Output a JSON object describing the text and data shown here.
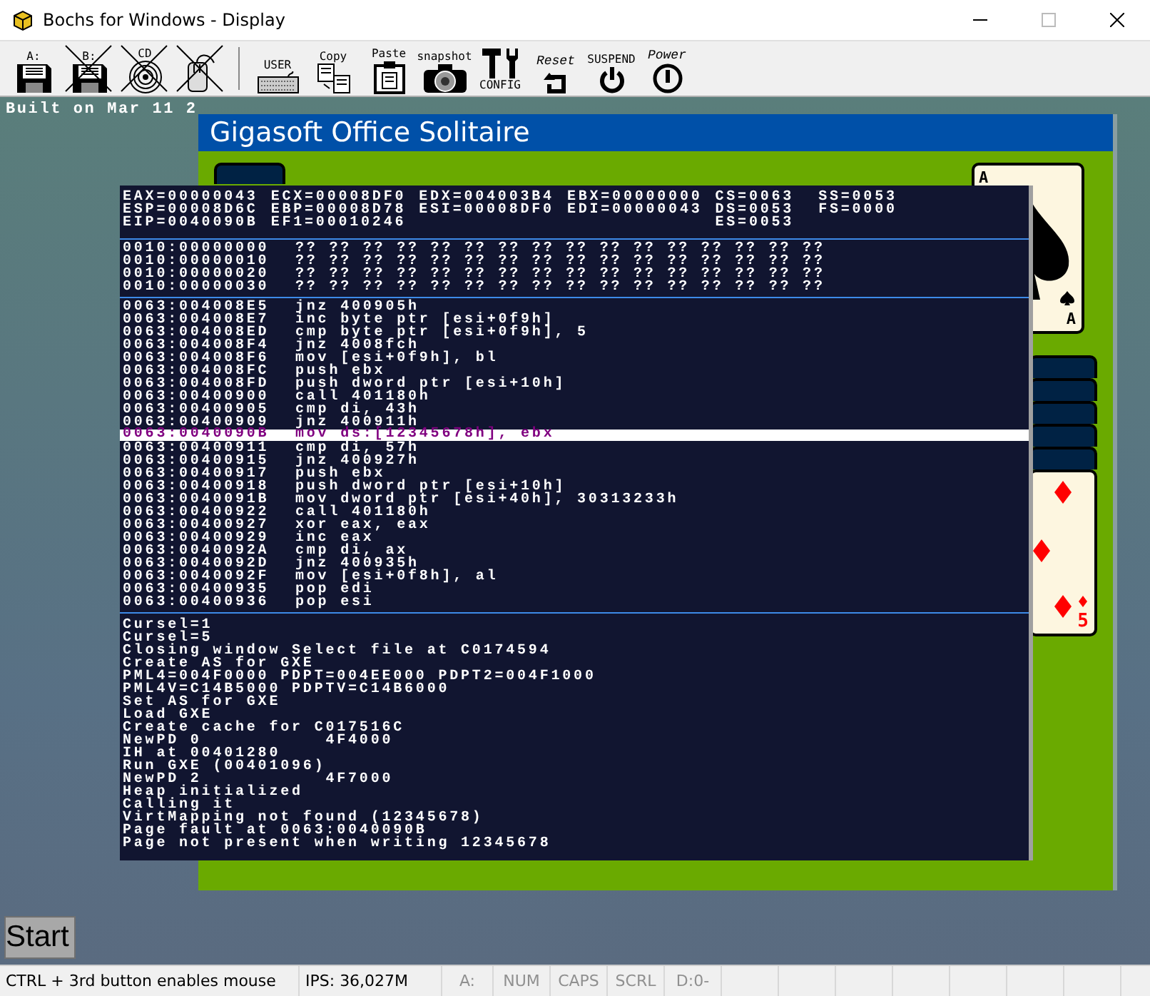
{
  "window": {
    "title": "Bochs for Windows - Display"
  },
  "toolbar": [
    {
      "kind": "floppy",
      "label": "A:",
      "disabled": false
    },
    {
      "kind": "floppy",
      "label": "B:",
      "disabled": true
    },
    {
      "kind": "cdrom",
      "label": "CD",
      "disabled": true
    },
    {
      "kind": "mouse",
      "disabled": true
    },
    {
      "kind": "separator"
    },
    {
      "kind": "keyboard",
      "label": "USER",
      "disabled": false
    },
    {
      "kind": "copy",
      "label": "Copy",
      "disabled": false
    },
    {
      "kind": "paste",
      "label": "Paste",
      "disabled": false
    },
    {
      "kind": "camera",
      "label": "snapshot",
      "disabled": false
    },
    {
      "kind": "config",
      "label": "CONFIG",
      "disabled": false
    },
    {
      "kind": "reset",
      "label": "Reset",
      "disabled": false
    },
    {
      "kind": "suspend",
      "label": "SUSPEND",
      "disabled": false
    },
    {
      "kind": "power",
      "label": "Power",
      "disabled": false
    }
  ],
  "display": {
    "boot_text": "Built on Mar 11 2",
    "solitaire": {
      "title": "Gigasoft Office Solitaire",
      "cards": [
        {
          "kind": "back"
        },
        {
          "kind": "spades",
          "corner_labels": [
            "A",
            "A"
          ]
        },
        {
          "kind": "diamond-stack",
          "corner_labels": [
            "5"
          ]
        }
      ]
    },
    "debugger": {
      "registers": [
        [
          "EAX=00000043",
          "ESP=00008D6C",
          "EIP=0040090B"
        ],
        [
          "ECX=00008DF0",
          "EBP=00008D78",
          "EF1=00010246"
        ],
        [
          "EDX=004003B4",
          "ESI=00008DF0"
        ],
        [
          "EBX=00000000",
          "EDI=00000043"
        ],
        [
          "CS=0063",
          "DS=0053",
          "ES=0053"
        ],
        [
          "SS=0053",
          "FS=0000"
        ]
      ],
      "memory": [
        {
          "address": "0010:00000000",
          "bytes": "?? ?? ?? ?? ?? ?? ?? ?? ?? ?? ?? ?? ?? ?? ?? ??"
        },
        {
          "address": "0010:00000010",
          "bytes": "?? ?? ?? ?? ?? ?? ?? ?? ?? ?? ?? ?? ?? ?? ?? ??"
        },
        {
          "address": "0010:00000020",
          "bytes": "?? ?? ?? ?? ?? ?? ?? ?? ?? ?? ?? ?? ?? ?? ?? ??"
        },
        {
          "address": "0010:00000030",
          "bytes": "?? ?? ?? ?? ?? ?? ?? ?? ?? ?? ?? ?? ?? ?? ?? ??"
        }
      ],
      "disassembly": [
        {
          "address": "0063:004008E5",
          "instruction": "jnz 400905h",
          "selected": false
        },
        {
          "address": "0063:004008E7",
          "instruction": "inc byte ptr [esi+0f9h]",
          "selected": false
        },
        {
          "address": "0063:004008ED",
          "instruction": "cmp byte ptr [esi+0f9h], 5",
          "selected": false
        },
        {
          "address": "0063:004008F4",
          "instruction": "jnz 4008fch",
          "selected": false
        },
        {
          "address": "0063:004008F6",
          "instruction": "mov [esi+0f9h], bl",
          "selected": false
        },
        {
          "address": "0063:004008FC",
          "instruction": "push ebx",
          "selected": false
        },
        {
          "address": "0063:004008FD",
          "instruction": "push dword ptr [esi+10h]",
          "selected": false
        },
        {
          "address": "0063:00400900",
          "instruction": "call 401180h",
          "selected": false
        },
        {
          "address": "0063:00400905",
          "instruction": "cmp di, 43h",
          "selected": false
        },
        {
          "address": "0063:00400909",
          "instruction": "jnz 400911h",
          "selected": false
        },
        {
          "address": "0063:0040090B",
          "instruction": "mov ds:[12345678h], ebx",
          "selected": true
        },
        {
          "address": "0063:00400911",
          "instruction": "cmp di, 57h",
          "selected": false
        },
        {
          "address": "0063:00400915",
          "instruction": "jnz 400927h",
          "selected": false
        },
        {
          "address": "0063:00400917",
          "instruction": "push ebx",
          "selected": false
        },
        {
          "address": "0063:00400918",
          "instruction": "push dword ptr [esi+10h]",
          "selected": false
        },
        {
          "address": "0063:0040091B",
          "instruction": "mov dword ptr [esi+40h], 30313233h",
          "selected": false
        },
        {
          "address": "0063:00400922",
          "instruction": "call 401180h",
          "selected": false
        },
        {
          "address": "0063:00400927",
          "instruction": "xor eax, eax",
          "selected": false
        },
        {
          "address": "0063:00400929",
          "instruction": "inc eax",
          "selected": false
        },
        {
          "address": "0063:0040092A",
          "instruction": "cmp di, ax",
          "selected": false
        },
        {
          "address": "0063:0040092D",
          "instruction": "jnz 400935h",
          "selected": false
        },
        {
          "address": "0063:0040092F",
          "instruction": "mov [esi+0f8h], al",
          "selected": false
        },
        {
          "address": "0063:00400935",
          "instruction": "pop edi",
          "selected": false
        },
        {
          "address": "0063:00400936",
          "instruction": "pop esi",
          "selected": false
        }
      ],
      "log": [
        "Cursel=1",
        "Cursel=5",
        "Closing window Select file at C0174594",
        "Create AS for GXE",
        "PML4=004F0000 PDPT=004EE000 PDPT2=004F1000",
        "PML4V=C14B5000 PDPTV=C14B6000",
        "Set AS for GXE",
        "Load GXE",
        "Create cache for C017516C",
        "NewPD 0           4F4000",
        "IH at 00401280",
        "Run GXE (00401096)",
        "NewPD 2           4F7000",
        "Heap initialized",
        "Calling it",
        "VirtMapping not found (12345678)",
        "Page fault at 0063:0040090B",
        "Page not present when writing 12345678"
      ]
    },
    "start_button": "Start"
  },
  "status_bar": [
    {
      "text": "CTRL + 3rd button enables mouse",
      "active": true
    },
    {
      "text": "IPS: 36,027M",
      "active": true
    },
    {
      "text": "A:",
      "active": false
    },
    {
      "text": "NUM",
      "active": false
    },
    {
      "text": "CAPS",
      "active": false
    },
    {
      "text": "SCRL",
      "active": false
    },
    {
      "text": "D:0-",
      "active": false
    }
  ]
}
